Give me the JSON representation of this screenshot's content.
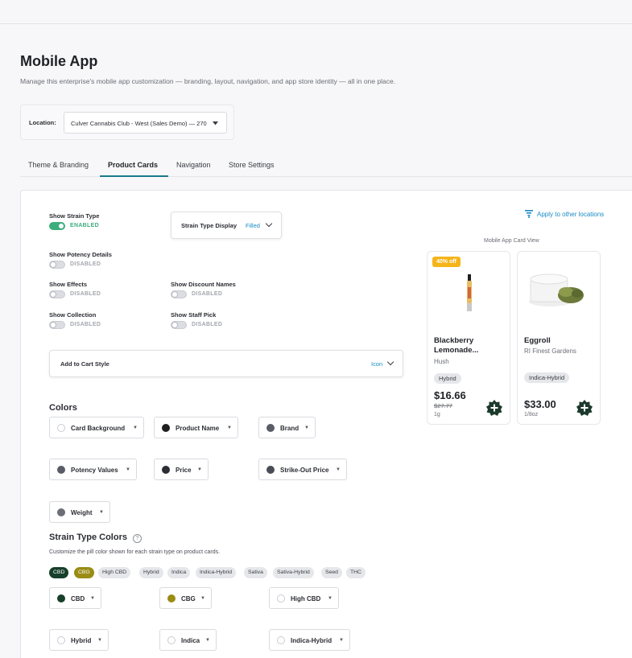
{
  "header": {
    "title": "Mobile App",
    "description": "Manage this enterprise's mobile app customization — branding, layout, navigation, and app store identity — all in one place."
  },
  "location": {
    "label": "Location:",
    "value": "Culver Cannabis Club - West (Sales Demo) — 270"
  },
  "tabs": [
    {
      "label": "Theme & Branding"
    },
    {
      "label": "Product Cards"
    },
    {
      "label": "Navigation"
    },
    {
      "label": "Store Settings"
    }
  ],
  "active_tab": "Product Cards",
  "toggles": {
    "strain_type": {
      "title": "Show Strain Type",
      "state": "ENABLED",
      "on": true
    },
    "potency": {
      "title": "Show Potency Details",
      "state": "DISABLED",
      "on": false
    },
    "effects": {
      "title": "Show Effects",
      "state": "DISABLED",
      "on": false
    },
    "discount": {
      "title": "Show Discount Names",
      "state": "DISABLED",
      "on": false
    },
    "collection": {
      "title": "Show Collection",
      "state": "DISABLED",
      "on": false
    },
    "staff_pick": {
      "title": "Show Staff Pick",
      "state": "DISABLED",
      "on": false
    }
  },
  "strain_display": {
    "label": "Strain Type Display",
    "value": "Filled"
  },
  "add_to_cart": {
    "label": "Add to Cart Style",
    "value": "Icon"
  },
  "apply_link": "Apply to other locations",
  "colors": {
    "title": "Colors",
    "items": [
      {
        "label": "Card Background",
        "color": "#ffffff"
      },
      {
        "label": "Product Name",
        "color": "#1f1f1f"
      },
      {
        "label": "Brand",
        "color": "#5a5d66"
      },
      {
        "label": "Potency Values",
        "color": "#5a5d66"
      },
      {
        "label": "Price",
        "color": "#2b2d33"
      },
      {
        "label": "Strike-Out Price",
        "color": "#4a4d55"
      },
      {
        "label": "Weight",
        "color": "#6b6e76"
      }
    ]
  },
  "strain_colors": {
    "title": "Strain Type Colors",
    "subtitle": "Customize the pill color shown for each strain type on product cards.",
    "pills": [
      "CBD",
      "CBG",
      "High CBD",
      "Hybrid",
      "Indica",
      "Indica-Hybrid",
      "Sativa",
      "Sativa-Hybrid",
      "Seed",
      "THC"
    ],
    "items": [
      {
        "label": "CBD",
        "color": "#173f2a"
      },
      {
        "label": "CBG",
        "color": "#9a8c14"
      },
      {
        "label": "High CBD",
        "color": "#ffffff"
      },
      {
        "label": "Hybrid",
        "color": "#ffffff"
      },
      {
        "label": "Indica",
        "color": "#ffffff"
      },
      {
        "label": "Indica-Hybrid",
        "color": "#ffffff"
      }
    ]
  },
  "preview": {
    "label": "Mobile App Card View",
    "cards": [
      {
        "badge": "40% off",
        "name_line1": "Blackberry",
        "name_line2": "Lemonade...",
        "brand": "Hush",
        "strain": "Hybrid",
        "price": "$16.66",
        "strike": "$27.77",
        "weight": "1g"
      },
      {
        "badge": "",
        "name_line1": "Eggroll",
        "name_line2": "",
        "brand": "RI Finest Gardens",
        "strain": "Indica-Hybrid",
        "price": "$33.00",
        "strike": "",
        "weight": "1/8oz"
      }
    ]
  },
  "accent": {
    "toggle_on": "#3cae7c",
    "link": "#1a8bc4",
    "tab_underline": "#1a7a8c",
    "badge": "#f5b41a",
    "add_button": "#1c3a2c"
  }
}
